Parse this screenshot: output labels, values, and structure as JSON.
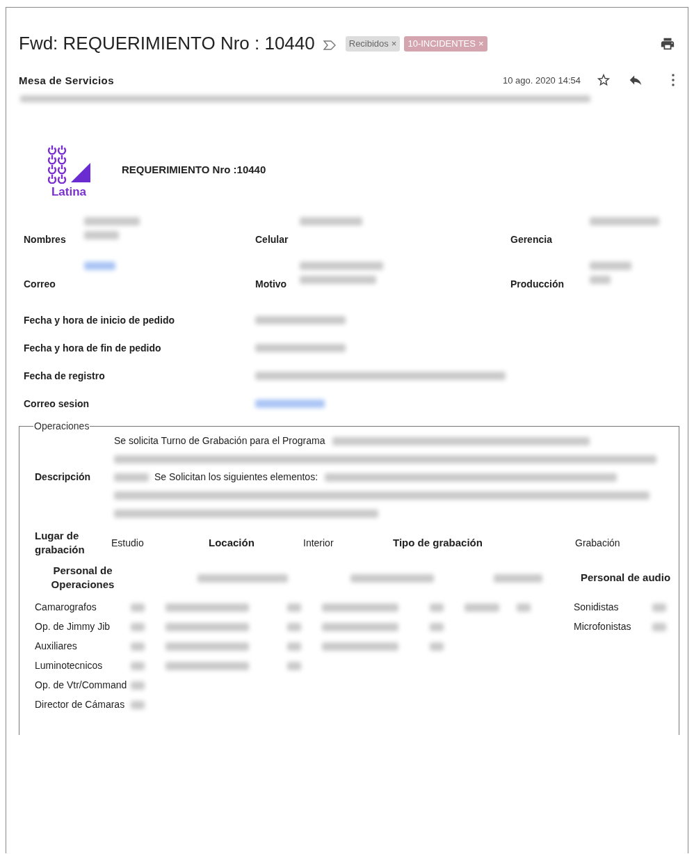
{
  "subject": "Fwd: REQUERIMIENTO Nro : 10440",
  "labels": [
    {
      "name": "Recibidos",
      "close": "×",
      "color": "#dddddd"
    },
    {
      "name": "10-INCIDENTES",
      "close": "×",
      "color": "#d4a5ae"
    }
  ],
  "sender": "Mesa de Servicios",
  "date": "10 ago. 2020 14:54",
  "recipients_blurred": true,
  "logo_text": "Latina",
  "heading": "REQUERIMIENTO Nro :10440",
  "grid_fields": [
    {
      "label": "Nombres",
      "kind": "text",
      "blurred": true
    },
    {
      "label": "Celular",
      "kind": "text",
      "blurred": true
    },
    {
      "label": "Gerencia",
      "kind": "text",
      "blurred": true
    },
    {
      "label": "Correo",
      "kind": "link",
      "blurred": true
    },
    {
      "label": "Motivo",
      "kind": "text",
      "blurred": true
    },
    {
      "label": "Producción",
      "kind": "text",
      "blurred": true
    }
  ],
  "fields": [
    {
      "label": "Fecha y hora de inicio de pedido",
      "kind": "text",
      "blurred": true
    },
    {
      "label": "Fecha y hora de fin de pedido",
      "kind": "text",
      "blurred": true
    },
    {
      "label": "Fecha de registro",
      "kind": "text",
      "blurred": true
    },
    {
      "label": "Correo sesion",
      "kind": "link",
      "blurred": true
    }
  ],
  "operaciones": {
    "legend": "Operaciones",
    "description": {
      "label": "Descripción",
      "segments": [
        {
          "kind": "text",
          "text": "Se solicita Turno de Grabación para el Programa"
        },
        {
          "kind": "blur",
          "blurred": true
        },
        {
          "kind": "blur",
          "blurred": true
        },
        {
          "kind": "blur",
          "blurred": true
        },
        {
          "kind": "text",
          "text": "Se Solicitan los siguientes elementos:"
        },
        {
          "kind": "blur",
          "blurred": true
        },
        {
          "kind": "blur",
          "blurred": true
        },
        {
          "kind": "blur",
          "blurred": true
        }
      ]
    },
    "details": [
      {
        "label": "Lugar de grabación",
        "value": "Estudio"
      },
      {
        "label": "Locación",
        "value": "Interior"
      },
      {
        "label": "Tipo de grabación",
        "value": "Grabación"
      }
    ],
    "columns": [
      {
        "header": {
          "text": "Personal de Operaciones"
        },
        "items": [
          {
            "text": "Camarografos",
            "count_blurred": true
          },
          {
            "text": "Op. de Jimmy Jib",
            "count_blurred": true
          },
          {
            "text": "Auxiliares",
            "count_blurred": true
          },
          {
            "text": "Luminotecnicos",
            "count_blurred": true
          },
          {
            "text": "Op. de Vtr/Command",
            "count_blurred": true
          },
          {
            "text": "Director de Cámaras",
            "count_blurred": true
          }
        ]
      },
      {
        "header": {
          "blurred": true
        },
        "items": [
          {
            "blurred": true,
            "count_blurred": true
          },
          {
            "blurred": true,
            "count_blurred": true
          },
          {
            "blurred": true,
            "count_blurred": true
          },
          {
            "blurred": true,
            "count_blurred": true
          }
        ]
      },
      {
        "header": {
          "blurred": true
        },
        "items": [
          {
            "blurred": true,
            "count_blurred": true
          },
          {
            "blurred": true,
            "count_blurred": true
          },
          {
            "blurred": true,
            "count_blurred": true
          }
        ]
      },
      {
        "header": {
          "blurred": true
        },
        "items": [
          {
            "blurred": true,
            "count_blurred": true
          }
        ]
      },
      {
        "header": {
          "text": "Personal de audio"
        },
        "items": [
          {
            "text": "Sonidistas",
            "count_blurred": true
          },
          {
            "text": "Microfonistas",
            "count_blurred": true
          }
        ]
      }
    ]
  }
}
